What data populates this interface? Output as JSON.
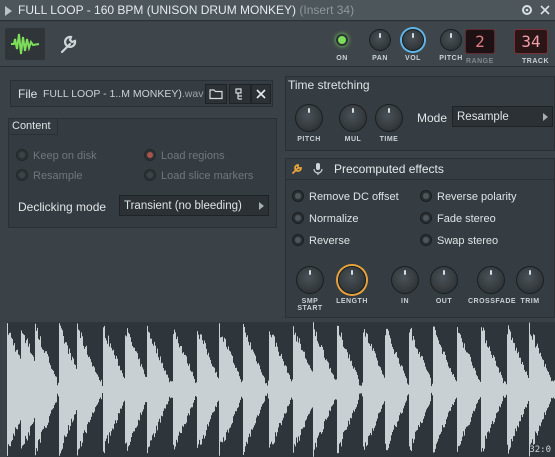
{
  "titlebar": {
    "title": "FULL LOOP - 160 BPM (UNISON DRUM MONKEY)",
    "insert": "(Insert 34)",
    "menu_icon": "triangle-right-icon",
    "settings_icon": "gear-icon",
    "close_icon": "close-icon"
  },
  "toolbar": {
    "on_label": "ON",
    "pan_label": "PAN",
    "vol_label": "VOL",
    "pitch_label": "PITCH",
    "range_label": "RANGE",
    "range_value": "2",
    "track_label": "TRACK",
    "track_value": "34"
  },
  "file": {
    "label": "File",
    "name": "FULL LOOP - 1..M MONKEY)",
    "ext": ".wav",
    "icons": [
      "folder-icon",
      "locate-file-icon",
      "close-icon"
    ]
  },
  "content": {
    "title": "Content",
    "options": [
      {
        "label": "Keep on disk",
        "selected": false
      },
      {
        "label": "Load regions",
        "selected": true
      },
      {
        "label": "Resample",
        "selected": false
      },
      {
        "label": "Load slice markers",
        "selected": false
      }
    ],
    "declicking_label": "Declicking mode",
    "declicking_value": "Transient (no bleeding)"
  },
  "time_stretching": {
    "title": "Time stretching",
    "knobs": [
      "PITCH",
      "MUL",
      "TIME"
    ],
    "mode_label": "Mode",
    "mode_value": "Resample"
  },
  "precomputed": {
    "title": "Precomputed effects",
    "effects": [
      "Remove DC offset",
      "Reverse polarity",
      "Normalize",
      "Fade stereo",
      "Reverse",
      "Swap stereo"
    ],
    "knobs": [
      "SMP START",
      "LENGTH",
      "IN",
      "OUT",
      "CROSSFADE",
      "TRIM"
    ]
  },
  "waveform": {
    "time_label": "32:0"
  },
  "colors": {
    "led_on": "#7dde5a",
    "vol_ring": "#5fb6e8",
    "length_ring": "#e8a33b",
    "lcd_text": "#e07a83",
    "wave": "#c9d0d3"
  }
}
